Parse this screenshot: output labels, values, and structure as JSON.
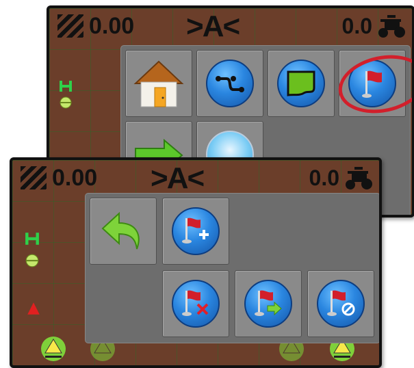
{
  "back_screen": {
    "speed": "0.00",
    "mode": ">A<",
    "right_value": "0.0",
    "menu": {
      "items": [
        {
          "icon": "home-icon"
        },
        {
          "icon": "guidance-path-icon"
        },
        {
          "icon": "boundary-icon"
        },
        {
          "icon": "marker-flag-icon",
          "highlighted": true
        },
        {
          "icon": "arrow-right-icon"
        },
        {
          "icon": "lightbar-icon"
        }
      ]
    }
  },
  "front_screen": {
    "speed": "0.00",
    "mode": ">A<",
    "right_value": "0.0",
    "menu": {
      "items": [
        {
          "icon": "back-arrow-icon"
        },
        {
          "icon": "add-marker-flag-icon"
        },
        {
          "icon": "delete-marker-flag-icon"
        },
        {
          "icon": "goto-marker-flag-icon"
        },
        {
          "icon": "cancel-marker-flag-icon"
        }
      ]
    }
  },
  "colors": {
    "field_brown": "#6b3e2a",
    "menu_gray": "#6d6d6d",
    "tile_gray": "#8a8a8a",
    "button_blue": "#2a86e0",
    "flag_red": "#d21f2b",
    "highlight_ring": "#d21f2b"
  }
}
